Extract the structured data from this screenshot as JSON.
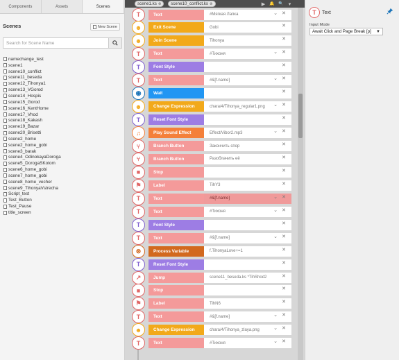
{
  "left_panel": {
    "tabs": [
      {
        "label": "Components",
        "active": false
      },
      {
        "label": "Assets",
        "active": false
      },
      {
        "label": "Scenes",
        "active": true
      }
    ],
    "title": "Scenes",
    "new_scene_label": "New Scene",
    "search_placeholder": "Search for Scene Name",
    "scenes": [
      "namechange_test",
      "scene1",
      "scene10_conflict",
      "scene11_beseda",
      "scene12_Tihonya1",
      "scene13_VGorod",
      "scene14_Hospis",
      "scene15_Gorod",
      "scene16_KentHome",
      "scene17_Vhod",
      "scene18_Kakash",
      "scene19_Bazar",
      "scene20_Brisetti",
      "scene2_home",
      "scene2_home_gobi",
      "scene3_barak",
      "scene4_OdinokayaDoroga",
      "scene5_DorogaSKotom",
      "scene6_home_gobi",
      "scene7_home_gobi",
      "scene8_home_vecher",
      "scene9_TihonyaVstrecha",
      "Script_test",
      "Test_Button",
      "Test_Pause",
      "title_screen"
    ]
  },
  "editor": {
    "file_tabs": [
      {
        "label": "scene1.ks"
      },
      {
        "label": "scene10_conflict.ks"
      }
    ],
    "controls": [
      {
        "icon": "play-icon",
        "glyph": "▶"
      },
      {
        "icon": "bell-icon",
        "glyph": "🔔"
      },
      {
        "icon": "search-icon",
        "glyph": "🔍"
      },
      {
        "icon": "chevron-down-icon",
        "glyph": "▾"
      }
    ],
    "commands": [
      {
        "label": "Text",
        "color": "#f49a9a",
        "icon": "T",
        "icon_color": "#e06666",
        "param": "#Мягкая Лапка",
        "chevron": true,
        "highlight": false
      },
      {
        "label": "Exit Scene",
        "color": "#f2a91a",
        "icon": "☻",
        "icon_color": "#f2a91a",
        "param": "Gobi",
        "chevron": false,
        "highlight": false
      },
      {
        "label": "Join Scene",
        "color": "#f2a91a",
        "icon": "☻",
        "icon_color": "#f2a91a",
        "param": "Tihonya",
        "chevron": false,
        "highlight": false
      },
      {
        "label": "Text",
        "color": "#f49a9a",
        "icon": "T",
        "icon_color": "#e06666",
        "param": "#Тихоня",
        "chevron": true,
        "highlight": false
      },
      {
        "label": "Font Style",
        "color": "#9d7de4",
        "icon": "T",
        "icon_color": "#8060d0",
        "param": "",
        "chevron": false,
        "highlight": false
      },
      {
        "label": "Text",
        "color": "#f49a9a",
        "icon": "T",
        "icon_color": "#e06666",
        "param": "#&[f.name]",
        "chevron": true,
        "highlight": false
      },
      {
        "label": "Wait",
        "color": "#2196f3",
        "icon": "◉",
        "icon_color": "#1a73b8",
        "param": "",
        "chevron": false,
        "highlight": false
      },
      {
        "label": "Change Expression",
        "color": "#f2a91a",
        "icon": "☻",
        "icon_color": "#f2a91a",
        "param": "chara/4/Tihonya_regular1.png",
        "chevron": true,
        "highlight": false
      },
      {
        "label": "Reset Font Style",
        "color": "#9d7de4",
        "icon": "T",
        "icon_color": "#8060d0",
        "param": "",
        "chevron": false,
        "highlight": false
      },
      {
        "label": "Play Sound Effect",
        "color": "#f4803a",
        "icon": "♫",
        "icon_color": "#f4803a",
        "param": "Effect/Vibor2.mp3",
        "chevron": true,
        "highlight": false
      },
      {
        "label": "Branch Button",
        "color": "#f49a9a",
        "icon": "⑂",
        "icon_color": "#e06666",
        "param": "Закончить спор",
        "chevron": false,
        "highlight": false
      },
      {
        "label": "Branch Button",
        "color": "#f49a9a",
        "icon": "⑂",
        "icon_color": "#e06666",
        "param": "Разоблачить её",
        "chevron": false,
        "highlight": false
      },
      {
        "label": "Stop",
        "color": "#f49a9a",
        "icon": "■",
        "icon_color": "#e06666",
        "param": "",
        "chevron": false,
        "highlight": false
      },
      {
        "label": "Label",
        "color": "#f49a9a",
        "icon": "⚑",
        "icon_color": "#e06666",
        "param": "TihY3",
        "chevron": false,
        "highlight": false
      },
      {
        "label": "Text",
        "color": "#f49a9a",
        "icon": "T",
        "icon_color": "#e06666",
        "param": "#&[f.name]",
        "chevron": true,
        "highlight": true
      },
      {
        "label": "Text",
        "color": "#f49a9a",
        "icon": "T",
        "icon_color": "#e06666",
        "param": "#Тихоня",
        "chevron": true,
        "highlight": false
      },
      {
        "label": "Font Style",
        "color": "#9d7de4",
        "icon": "T",
        "icon_color": "#8060d0",
        "param": "",
        "chevron": false,
        "highlight": false
      },
      {
        "label": "Text",
        "color": "#f49a9a",
        "icon": "T",
        "icon_color": "#e06666",
        "param": "#&[f.name]",
        "chevron": true,
        "highlight": false
      },
      {
        "label": "Process Variable",
        "color": "#d2691e",
        "icon": "⊗",
        "icon_color": "#d2691e",
        "param": "f.TihonyaLove+=1",
        "chevron": false,
        "highlight": false
      },
      {
        "label": "Reset Font Style",
        "color": "#9d7de4",
        "icon": "T",
        "icon_color": "#8060d0",
        "param": "",
        "chevron": false,
        "highlight": false
      },
      {
        "label": "Jump",
        "color": "#f49a9a",
        "icon": "↗",
        "icon_color": "#e06666",
        "param": "scene11_beseda.ks *TihShod2",
        "chevron": false,
        "highlight": false
      },
      {
        "label": "Stop",
        "color": "#f49a9a",
        "icon": "■",
        "icon_color": "#e06666",
        "param": "",
        "chevron": false,
        "highlight": false
      },
      {
        "label": "Label",
        "color": "#f49a9a",
        "icon": "⚑",
        "icon_color": "#e06666",
        "param": "TihN6",
        "chevron": false,
        "highlight": false
      },
      {
        "label": "Text",
        "color": "#f49a9a",
        "icon": "T",
        "icon_color": "#e06666",
        "param": "#&[f.name]",
        "chevron": true,
        "highlight": false
      },
      {
        "label": "Change Expression",
        "color": "#f2a91a",
        "icon": "☻",
        "icon_color": "#f2a91a",
        "param": "chara/4/Tihonya_zlaya.png",
        "chevron": true,
        "highlight": false
      },
      {
        "label": "Text",
        "color": "#f49a9a",
        "icon": "T",
        "icon_color": "#e06666",
        "param": "#Тихоня",
        "chevron": true,
        "highlight": false
      }
    ]
  },
  "properties": {
    "title": "Text",
    "input_mode_label": "Input Mode",
    "input_mode_value": "Await Click and Page Break [p]",
    "accent": "#1a73b8"
  }
}
